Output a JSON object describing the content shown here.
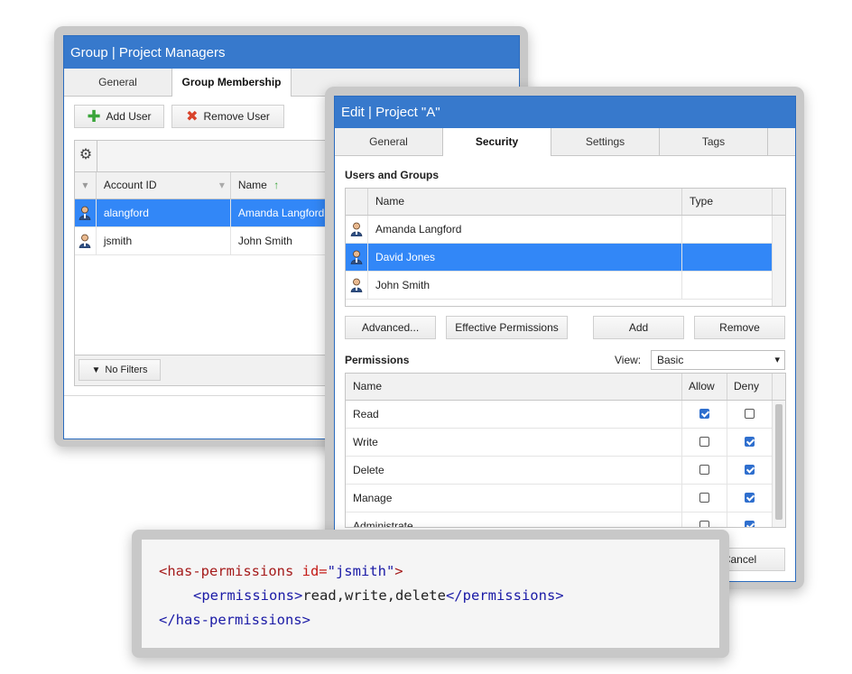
{
  "group_window": {
    "title": "Group | Project Managers",
    "tabs": [
      "General",
      "Group Membership"
    ],
    "add_user": "Add User",
    "remove_user": "Remove User",
    "columns": [
      "Account ID",
      "Name"
    ],
    "rows": [
      {
        "account": "alangford",
        "name": "Amanda Langford"
      },
      {
        "account": "jsmith",
        "name": "John Smith"
      }
    ],
    "no_filters": "No Filters"
  },
  "edit_window": {
    "title": "Edit | Project \"A\"",
    "tabs": [
      "General",
      "Security",
      "Settings",
      "Tags"
    ],
    "users_groups_label": "Users and Groups",
    "users_columns": [
      "Name",
      "Type"
    ],
    "users": [
      "Amanda Langford",
      "David Jones",
      "John Smith"
    ],
    "buttons": {
      "advanced": "Advanced...",
      "effective": "Effective Permissions",
      "add": "Add",
      "remove": "Remove",
      "cancel": "Cancel"
    },
    "permissions_label": "Permissions",
    "view_label": "View:",
    "view_value": "Basic",
    "perm_columns": [
      "Name",
      "Allow",
      "Deny"
    ],
    "permissions": [
      {
        "name": "Read",
        "allow": true,
        "deny": false
      },
      {
        "name": "Write",
        "allow": false,
        "deny": true
      },
      {
        "name": "Delete",
        "allow": false,
        "deny": true
      },
      {
        "name": "Manage",
        "allow": false,
        "deny": true
      },
      {
        "name": "Administrate",
        "allow": false,
        "deny": true
      }
    ]
  },
  "code": {
    "line1_tag_open": "<has-permissions",
    "line1_attr": " id=",
    "line1_val": "\"jsmith\"",
    "line1_close": ">",
    "line2_open": "<permissions>",
    "line2_text": "read,write,delete",
    "line2_close": "</permissions>",
    "line3": "</has-permissions>"
  }
}
